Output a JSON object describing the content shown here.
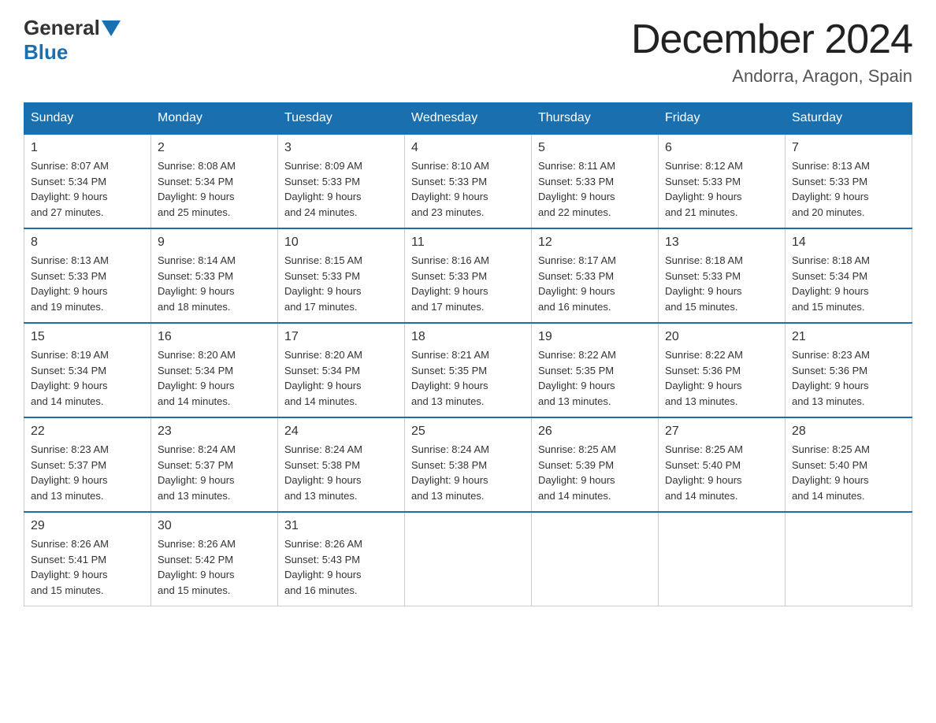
{
  "logo": {
    "text_general": "General",
    "text_blue": "Blue"
  },
  "title": "December 2024",
  "subtitle": "Andorra, Aragon, Spain",
  "header_days": [
    "Sunday",
    "Monday",
    "Tuesday",
    "Wednesday",
    "Thursday",
    "Friday",
    "Saturday"
  ],
  "weeks": [
    [
      {
        "day": "1",
        "sunrise": "8:07 AM",
        "sunset": "5:34 PM",
        "daylight": "9 hours and 27 minutes."
      },
      {
        "day": "2",
        "sunrise": "8:08 AM",
        "sunset": "5:34 PM",
        "daylight": "9 hours and 25 minutes."
      },
      {
        "day": "3",
        "sunrise": "8:09 AM",
        "sunset": "5:33 PM",
        "daylight": "9 hours and 24 minutes."
      },
      {
        "day": "4",
        "sunrise": "8:10 AM",
        "sunset": "5:33 PM",
        "daylight": "9 hours and 23 minutes."
      },
      {
        "day": "5",
        "sunrise": "8:11 AM",
        "sunset": "5:33 PM",
        "daylight": "9 hours and 22 minutes."
      },
      {
        "day": "6",
        "sunrise": "8:12 AM",
        "sunset": "5:33 PM",
        "daylight": "9 hours and 21 minutes."
      },
      {
        "day": "7",
        "sunrise": "8:13 AM",
        "sunset": "5:33 PM",
        "daylight": "9 hours and 20 minutes."
      }
    ],
    [
      {
        "day": "8",
        "sunrise": "8:13 AM",
        "sunset": "5:33 PM",
        "daylight": "9 hours and 19 minutes."
      },
      {
        "day": "9",
        "sunrise": "8:14 AM",
        "sunset": "5:33 PM",
        "daylight": "9 hours and 18 minutes."
      },
      {
        "day": "10",
        "sunrise": "8:15 AM",
        "sunset": "5:33 PM",
        "daylight": "9 hours and 17 minutes."
      },
      {
        "day": "11",
        "sunrise": "8:16 AM",
        "sunset": "5:33 PM",
        "daylight": "9 hours and 17 minutes."
      },
      {
        "day": "12",
        "sunrise": "8:17 AM",
        "sunset": "5:33 PM",
        "daylight": "9 hours and 16 minutes."
      },
      {
        "day": "13",
        "sunrise": "8:18 AM",
        "sunset": "5:33 PM",
        "daylight": "9 hours and 15 minutes."
      },
      {
        "day": "14",
        "sunrise": "8:18 AM",
        "sunset": "5:34 PM",
        "daylight": "9 hours and 15 minutes."
      }
    ],
    [
      {
        "day": "15",
        "sunrise": "8:19 AM",
        "sunset": "5:34 PM",
        "daylight": "9 hours and 14 minutes."
      },
      {
        "day": "16",
        "sunrise": "8:20 AM",
        "sunset": "5:34 PM",
        "daylight": "9 hours and 14 minutes."
      },
      {
        "day": "17",
        "sunrise": "8:20 AM",
        "sunset": "5:34 PM",
        "daylight": "9 hours and 14 minutes."
      },
      {
        "day": "18",
        "sunrise": "8:21 AM",
        "sunset": "5:35 PM",
        "daylight": "9 hours and 13 minutes."
      },
      {
        "day": "19",
        "sunrise": "8:22 AM",
        "sunset": "5:35 PM",
        "daylight": "9 hours and 13 minutes."
      },
      {
        "day": "20",
        "sunrise": "8:22 AM",
        "sunset": "5:36 PM",
        "daylight": "9 hours and 13 minutes."
      },
      {
        "day": "21",
        "sunrise": "8:23 AM",
        "sunset": "5:36 PM",
        "daylight": "9 hours and 13 minutes."
      }
    ],
    [
      {
        "day": "22",
        "sunrise": "8:23 AM",
        "sunset": "5:37 PM",
        "daylight": "9 hours and 13 minutes."
      },
      {
        "day": "23",
        "sunrise": "8:24 AM",
        "sunset": "5:37 PM",
        "daylight": "9 hours and 13 minutes."
      },
      {
        "day": "24",
        "sunrise": "8:24 AM",
        "sunset": "5:38 PM",
        "daylight": "9 hours and 13 minutes."
      },
      {
        "day": "25",
        "sunrise": "8:24 AM",
        "sunset": "5:38 PM",
        "daylight": "9 hours and 13 minutes."
      },
      {
        "day": "26",
        "sunrise": "8:25 AM",
        "sunset": "5:39 PM",
        "daylight": "9 hours and 14 minutes."
      },
      {
        "day": "27",
        "sunrise": "8:25 AM",
        "sunset": "5:40 PM",
        "daylight": "9 hours and 14 minutes."
      },
      {
        "day": "28",
        "sunrise": "8:25 AM",
        "sunset": "5:40 PM",
        "daylight": "9 hours and 14 minutes."
      }
    ],
    [
      {
        "day": "29",
        "sunrise": "8:26 AM",
        "sunset": "5:41 PM",
        "daylight": "9 hours and 15 minutes."
      },
      {
        "day": "30",
        "sunrise": "8:26 AM",
        "sunset": "5:42 PM",
        "daylight": "9 hours and 15 minutes."
      },
      {
        "day": "31",
        "sunrise": "8:26 AM",
        "sunset": "5:43 PM",
        "daylight": "9 hours and 16 minutes."
      },
      null,
      null,
      null,
      null
    ]
  ],
  "labels": {
    "sunrise": "Sunrise:",
    "sunset": "Sunset:",
    "daylight": "Daylight:"
  }
}
